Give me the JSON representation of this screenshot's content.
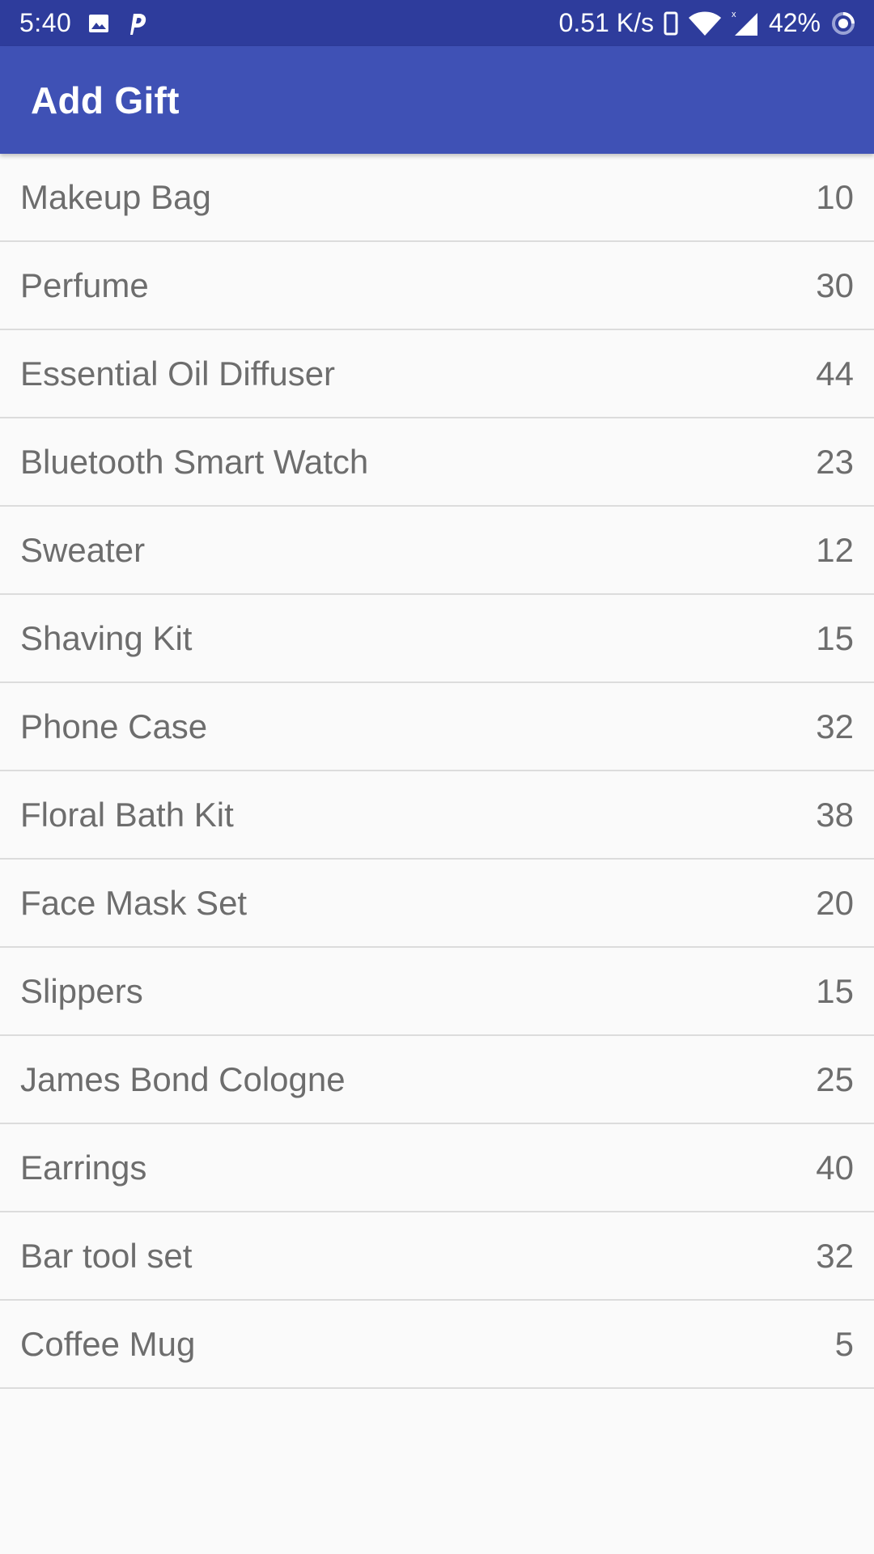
{
  "status_bar": {
    "time": "5:40",
    "left_icons": [
      "image-icon",
      "p-app-icon"
    ],
    "network_speed": "0.51 K/s",
    "right_icons": [
      "vibrate-icon",
      "wifi-icon",
      "signal-icon",
      "battery-ring-icon"
    ],
    "battery": "42%"
  },
  "app_bar": {
    "title": "Add Gift"
  },
  "colors": {
    "status_bar": "#2e3c9c",
    "app_bar": "#3f51b5",
    "background": "#fafafa",
    "text": "#6d6d6d",
    "divider": "#dcdcdc"
  },
  "gifts": [
    {
      "name": "Makeup Bag",
      "count": "10"
    },
    {
      "name": "Perfume",
      "count": "30"
    },
    {
      "name": "Essential Oil Diffuser",
      "count": "44"
    },
    {
      "name": "Bluetooth Smart Watch",
      "count": "23"
    },
    {
      "name": "Sweater",
      "count": "12"
    },
    {
      "name": "Shaving Kit",
      "count": "15"
    },
    {
      "name": "Phone Case",
      "count": "32"
    },
    {
      "name": "Floral Bath Kit",
      "count": "38"
    },
    {
      "name": "Face Mask Set",
      "count": "20"
    },
    {
      "name": "Slippers",
      "count": "15"
    },
    {
      "name": "James Bond Cologne",
      "count": "25"
    },
    {
      "name": "Earrings",
      "count": "40"
    },
    {
      "name": "Bar tool set",
      "count": "32"
    },
    {
      "name": "Coffee Mug",
      "count": "5"
    }
  ]
}
